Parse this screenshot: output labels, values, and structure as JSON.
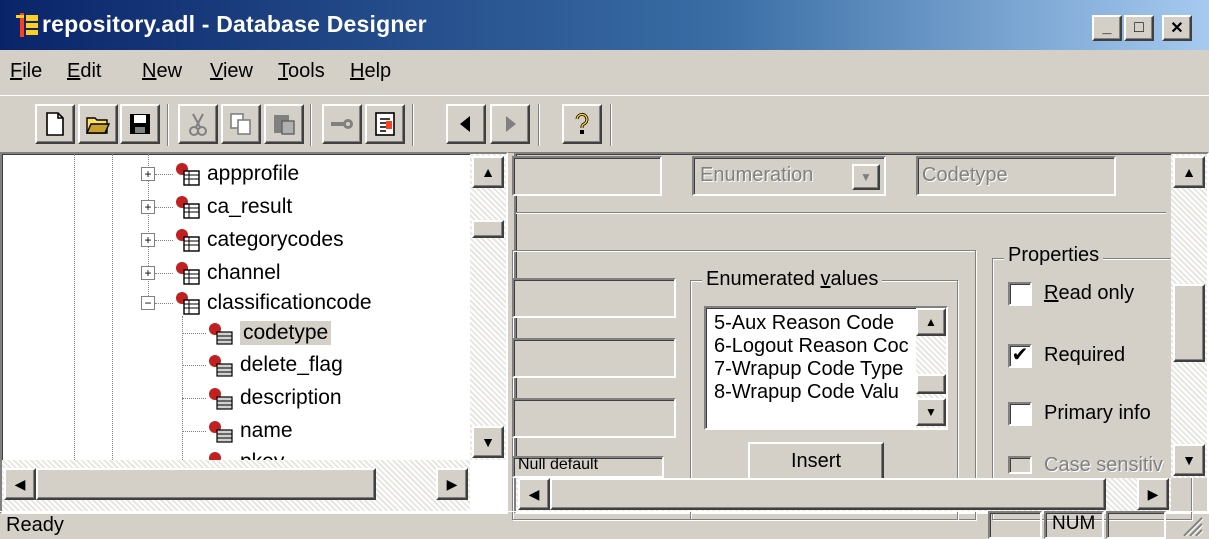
{
  "window": {
    "title": "repository.adl - Database Designer",
    "buttons": [
      "_",
      "□",
      "✕"
    ]
  },
  "menu": [
    {
      "label": "File",
      "accel": "F",
      "rest": "ile"
    },
    {
      "label": "Edit",
      "accel": "E",
      "rest": "dit"
    },
    {
      "label": "New",
      "accel": "N",
      "rest": "ew"
    },
    {
      "label": "View",
      "accel": "V",
      "rest": "iew"
    },
    {
      "label": "Tools",
      "accel": "T",
      "rest": "ools"
    },
    {
      "label": "Help",
      "accel": "H",
      "rest": "elp"
    }
  ],
  "toolbar": {
    "icons": [
      "new-file-icon",
      "open-folder-icon",
      "save-icon",
      "cut-icon",
      "copy-icon",
      "paste-icon",
      "key-icon",
      "properties-icon",
      "back-arrow-icon",
      "forward-arrow-icon",
      "help-icon"
    ]
  },
  "tree": {
    "tables": [
      {
        "name": "appprofile",
        "expander": "+"
      },
      {
        "name": "ca_result",
        "expander": "+"
      },
      {
        "name": "categorycodes",
        "expander": "+"
      },
      {
        "name": "channel",
        "expander": "+"
      },
      {
        "name": "classificationcode",
        "expander": "−"
      }
    ],
    "columns": [
      {
        "name": "codetype",
        "selected": true
      },
      {
        "name": "delete_flag",
        "selected": false
      },
      {
        "name": "description",
        "selected": false
      },
      {
        "name": "name",
        "selected": false
      },
      {
        "name": "pkey",
        "selected": false
      }
    ]
  },
  "editor": {
    "type_select": "Enumeration",
    "codetype_field": "Codetype",
    "partial_field_text": "Null default",
    "enumerated_values_label": "Enumerated values",
    "enumerated_values_accel": "v",
    "enumerated_values": [
      "5-Aux Reason Code",
      "6-Logout Reason Coc",
      "7-Wrapup Code Type",
      "8-Wrapup Code Valu"
    ],
    "insert_button": "Insert",
    "properties_label": "Properties",
    "properties": [
      {
        "label": "Read only",
        "accel": "R",
        "rest": "ead only",
        "checked": false,
        "disabled": false
      },
      {
        "label": "Required",
        "accel": "q",
        "checked": true,
        "disabled": false
      },
      {
        "label": "Primary info",
        "checked": false,
        "disabled": false
      },
      {
        "label": "Case sensitive",
        "checked": false,
        "disabled": true
      }
    ]
  },
  "status": {
    "text": "Ready",
    "panels": [
      "",
      "NUM",
      ""
    ]
  },
  "colors": {
    "title_start": "#0a246a",
    "title_end": "#a6caf0",
    "face": "#d4d0c8"
  }
}
